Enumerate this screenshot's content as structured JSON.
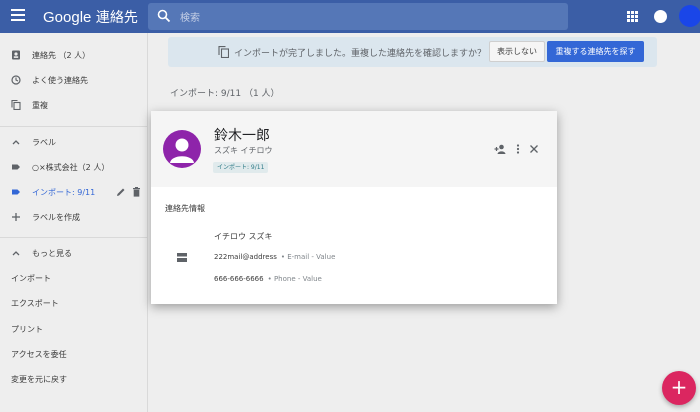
{
  "app": {
    "brand_google": "Google",
    "brand_product": "連絡先"
  },
  "search": {
    "placeholder": "検索"
  },
  "sidebar": {
    "contacts": "連絡先 （2 人）",
    "frequent": "よく使う連絡先",
    "duplicates": "重複",
    "labels_header": "ラベル",
    "label_company": "○×株式会社（2 人）",
    "label_import": "インポート: 9/11",
    "create_label": "ラベルを作成",
    "more": "もっと見る",
    "import": "インポート",
    "export": "エクスポート",
    "print": "プリント",
    "delegate": "アクセスを委任",
    "undo": "変更を元に戻す"
  },
  "banner": {
    "text": "インポートが完了しました。重複した連絡先を確認しますか？",
    "dismiss": "表示しない",
    "find": "重複する連絡先を探す"
  },
  "group_title": "インポート: 9/11 （1 人）",
  "contact": {
    "name": "鈴木一郎",
    "kana": "スズキ イチロウ",
    "label_chip": "インポート: 9/11",
    "section_title": "連絡先情報",
    "reading": "イチロウ スズキ",
    "email": "222mail@address",
    "email_type": "• E-mail - Value",
    "phone": "666-666-6666",
    "phone_type": "• Phone - Value"
  },
  "fab": {
    "label": "+"
  },
  "colors": {
    "topbar": "#3b5ea6",
    "accent": "#3367d6",
    "fab": "#db2660",
    "avatar": "#8e24aa"
  }
}
